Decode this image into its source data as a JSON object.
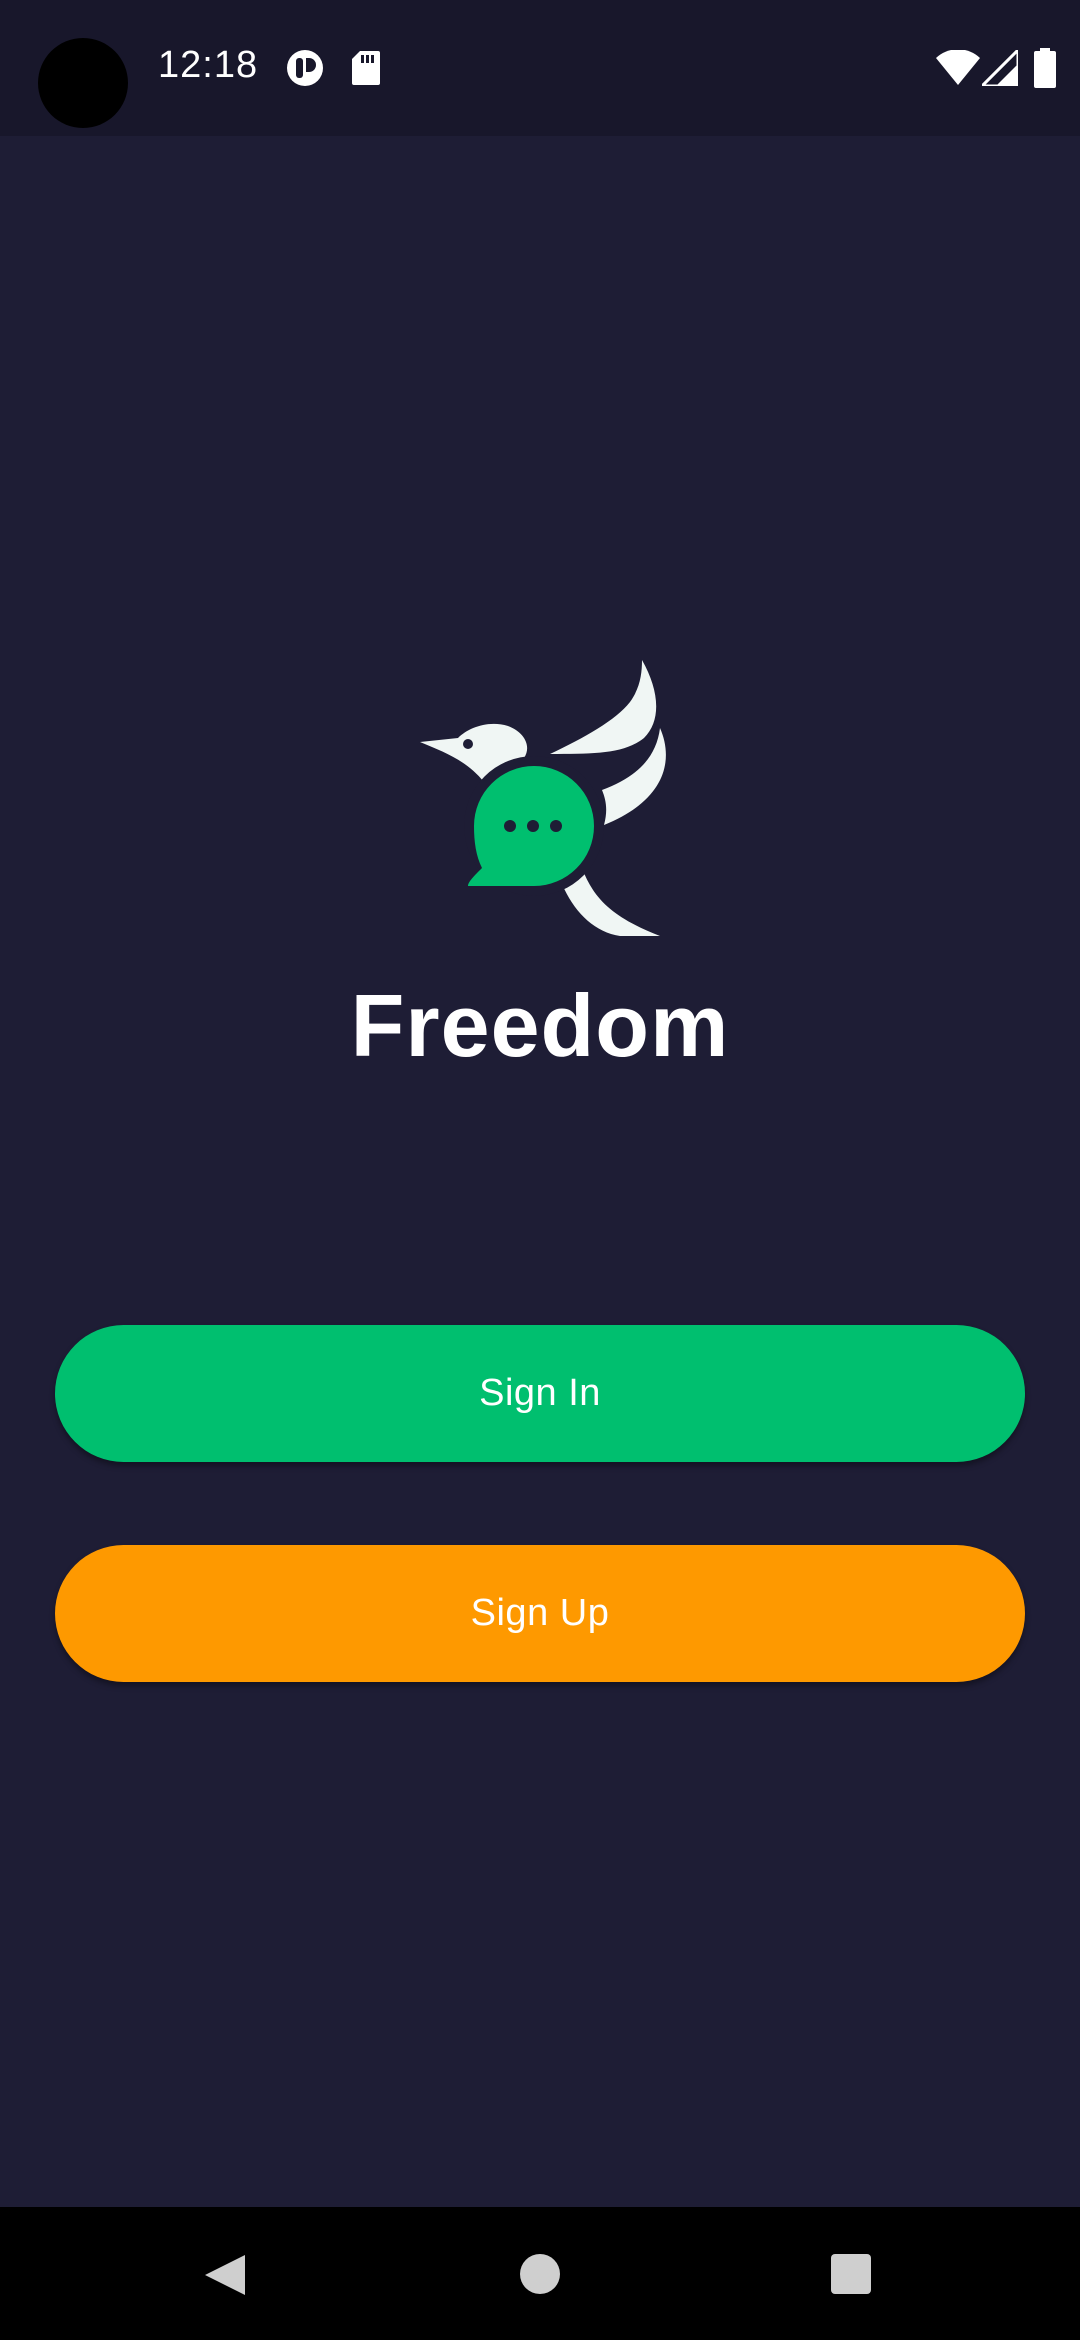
{
  "status_bar": {
    "time": "12:18",
    "left_icons": [
      "camera-cutout",
      "app-notification-icon",
      "sd-card-icon"
    ],
    "right_icons": [
      "wifi-icon",
      "cellular-signal-icon",
      "battery-icon"
    ]
  },
  "app": {
    "name": "Freedom",
    "logo": "bird-chat-bubble-logo"
  },
  "buttons": {
    "sign_in": "Sign In",
    "sign_up": "Sign Up"
  },
  "navigation": {
    "items": [
      "back",
      "home",
      "recents"
    ]
  },
  "colors": {
    "background": "#1e1d35",
    "status_bar": "#18172b",
    "sign_in": "#00bf6f",
    "sign_up": "#fe9900",
    "text": "#ffffff"
  }
}
